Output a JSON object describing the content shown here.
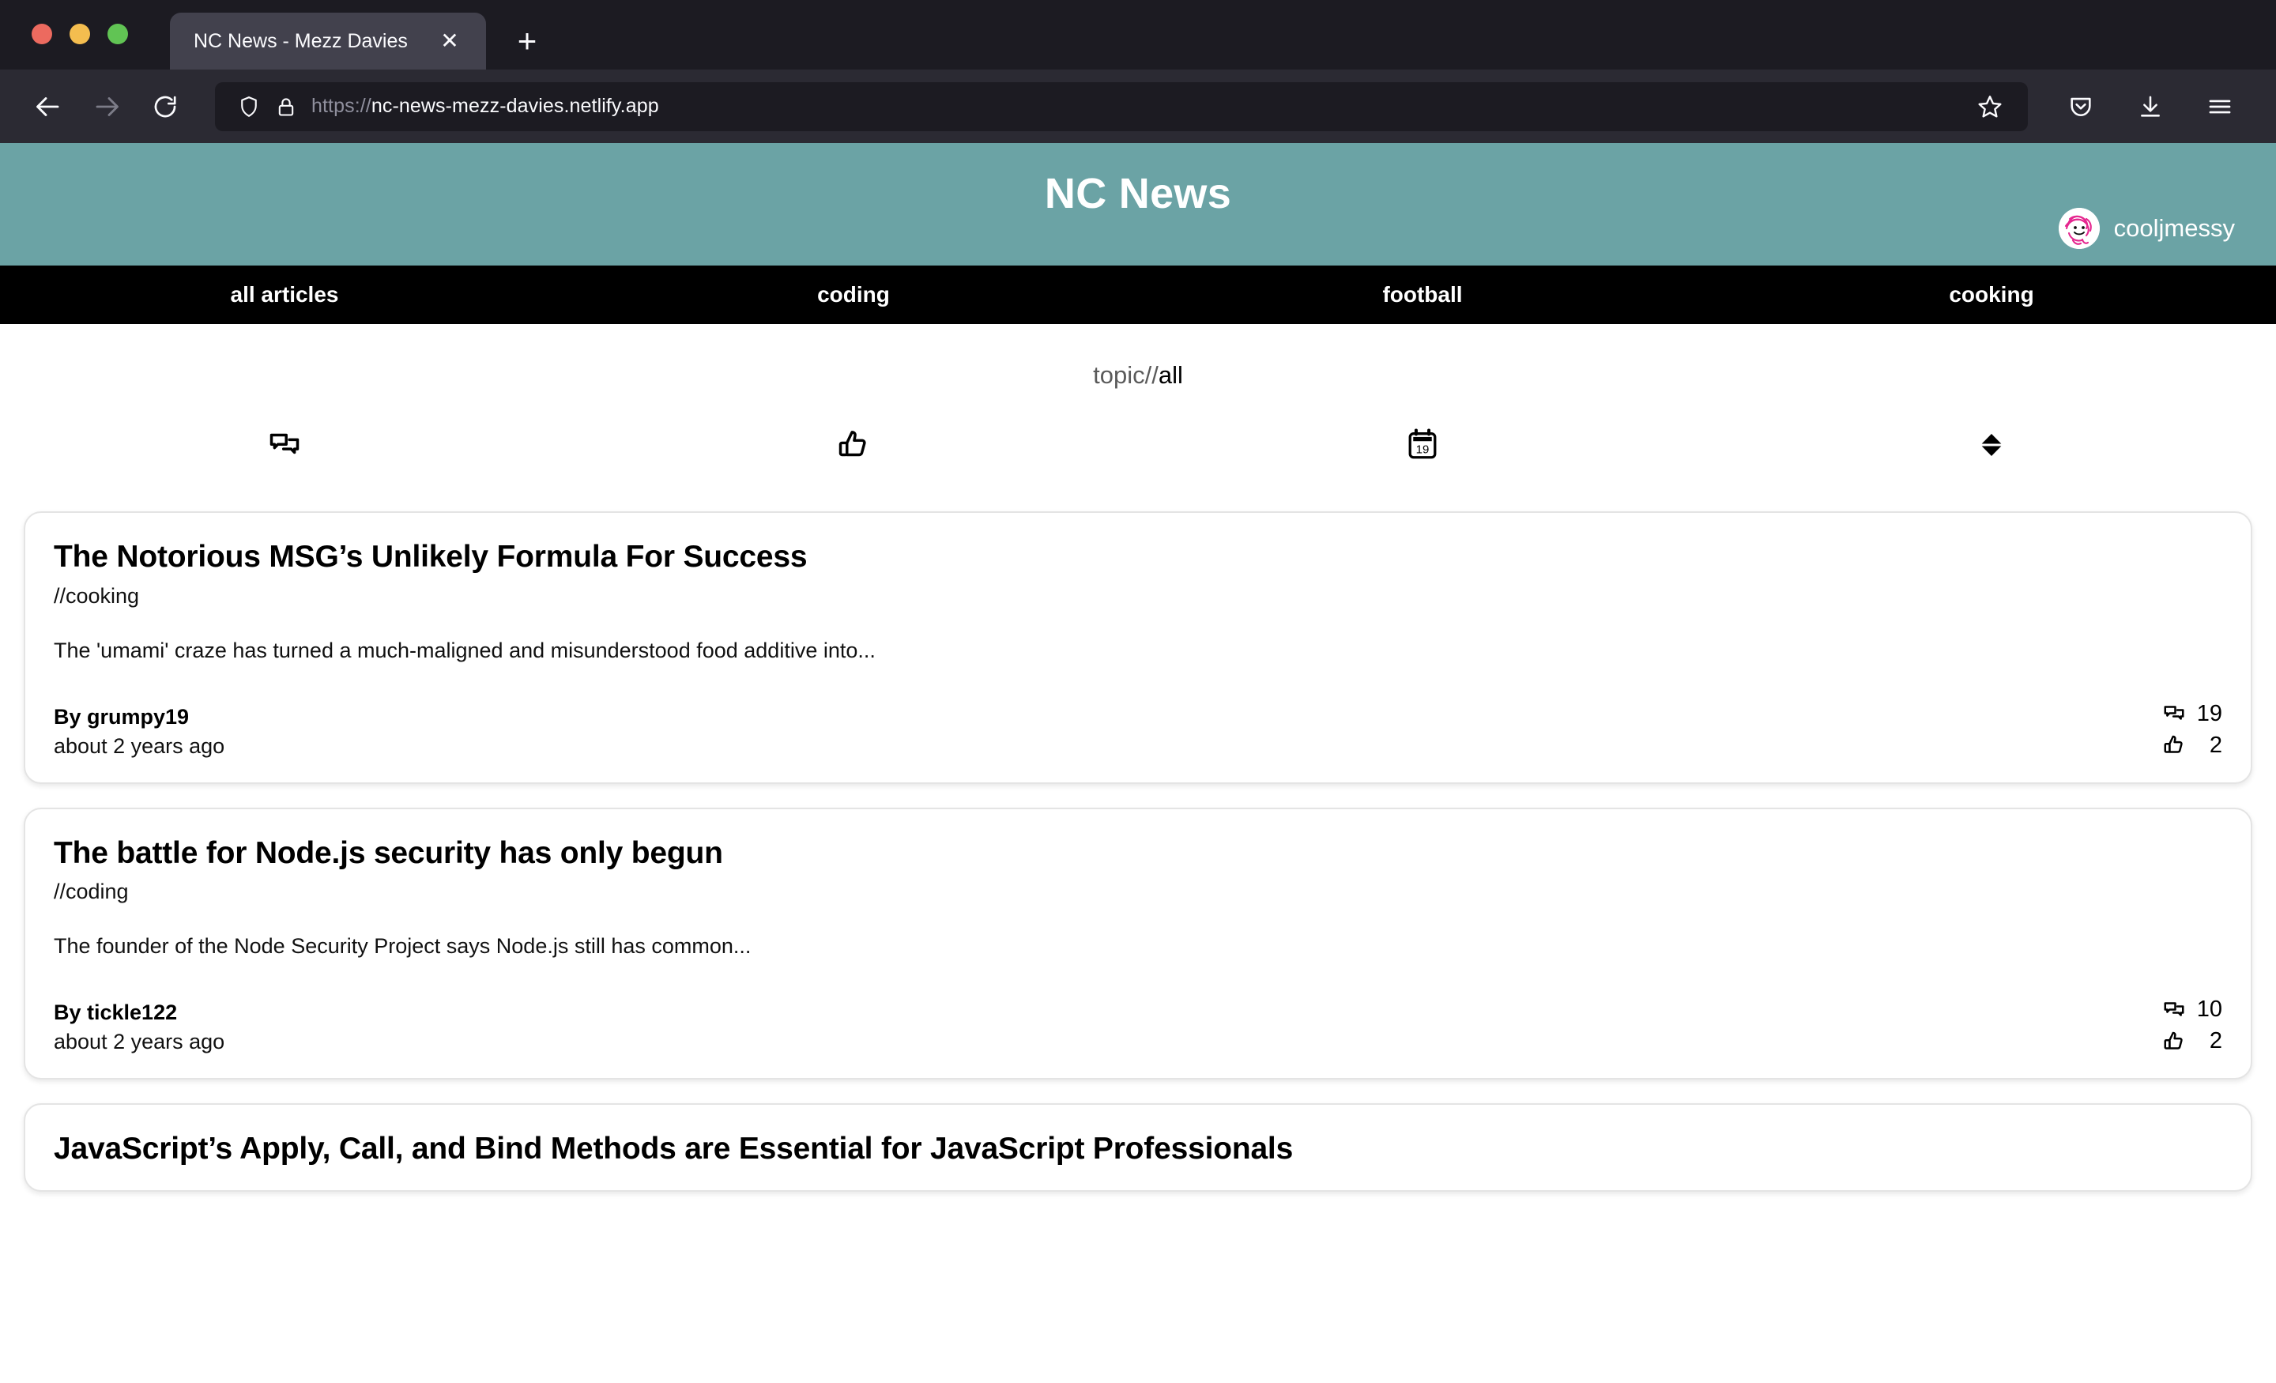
{
  "browser": {
    "tab_title": "NC News - Mezz Davies",
    "close_label": "✕",
    "newtab_label": "+",
    "url_scheme": "https://",
    "url_host": "nc-news-mezz-davies.netlify.app",
    "back_icon": "back-arrow-icon",
    "forward_icon": "forward-arrow-icon",
    "reload_icon": "reload-icon",
    "shield_icon": "shield-icon",
    "lock_icon": "lock-icon",
    "bookmark_icon": "star-icon",
    "pocket_icon": "pocket-icon",
    "download_icon": "download-icon",
    "menu_icon": "hamburger-menu-icon"
  },
  "site": {
    "title": "NC News",
    "accent_color": "#6ba3a5",
    "user": {
      "name": "cooljmessy",
      "avatar": "mr-messy-avatar"
    }
  },
  "topnav": [
    {
      "label": "all articles",
      "name": "nav-all-articles"
    },
    {
      "label": "coding",
      "name": "nav-coding"
    },
    {
      "label": "football",
      "name": "nav-football"
    },
    {
      "label": "cooking",
      "name": "nav-cooking"
    }
  ],
  "topic": {
    "prefix": "topic//",
    "value": "all"
  },
  "sortbar": [
    {
      "icon": "comments-icon",
      "name": "sort-by-comments"
    },
    {
      "icon": "thumbs-up-icon",
      "name": "sort-by-votes"
    },
    {
      "icon": "calendar-icon",
      "name": "sort-by-date",
      "day": "19"
    },
    {
      "icon": "sort-order-icon",
      "name": "sort-order-toggle"
    }
  ],
  "articles": [
    {
      "title": "The Notorious MSG’s Unlikely Formula For Success",
      "topic": "//cooking",
      "body": "The 'umami' craze has turned a much-maligned and misunderstood food additive into...",
      "author": "By grumpy19",
      "date": "about 2 years ago",
      "comment_count": "19",
      "vote_count": "2"
    },
    {
      "title": "The battle for Node.js security has only begun",
      "topic": "//coding",
      "body": "The founder of the Node Security Project says Node.js still has common...",
      "author": "By tickle122",
      "date": "about 2 years ago",
      "comment_count": "10",
      "vote_count": "2"
    },
    {
      "title": "JavaScript’s Apply, Call, and Bind Methods are Essential for JavaScript Professionals",
      "topic": "",
      "body": "",
      "author": "",
      "date": "",
      "comment_count": "",
      "vote_count": ""
    }
  ]
}
